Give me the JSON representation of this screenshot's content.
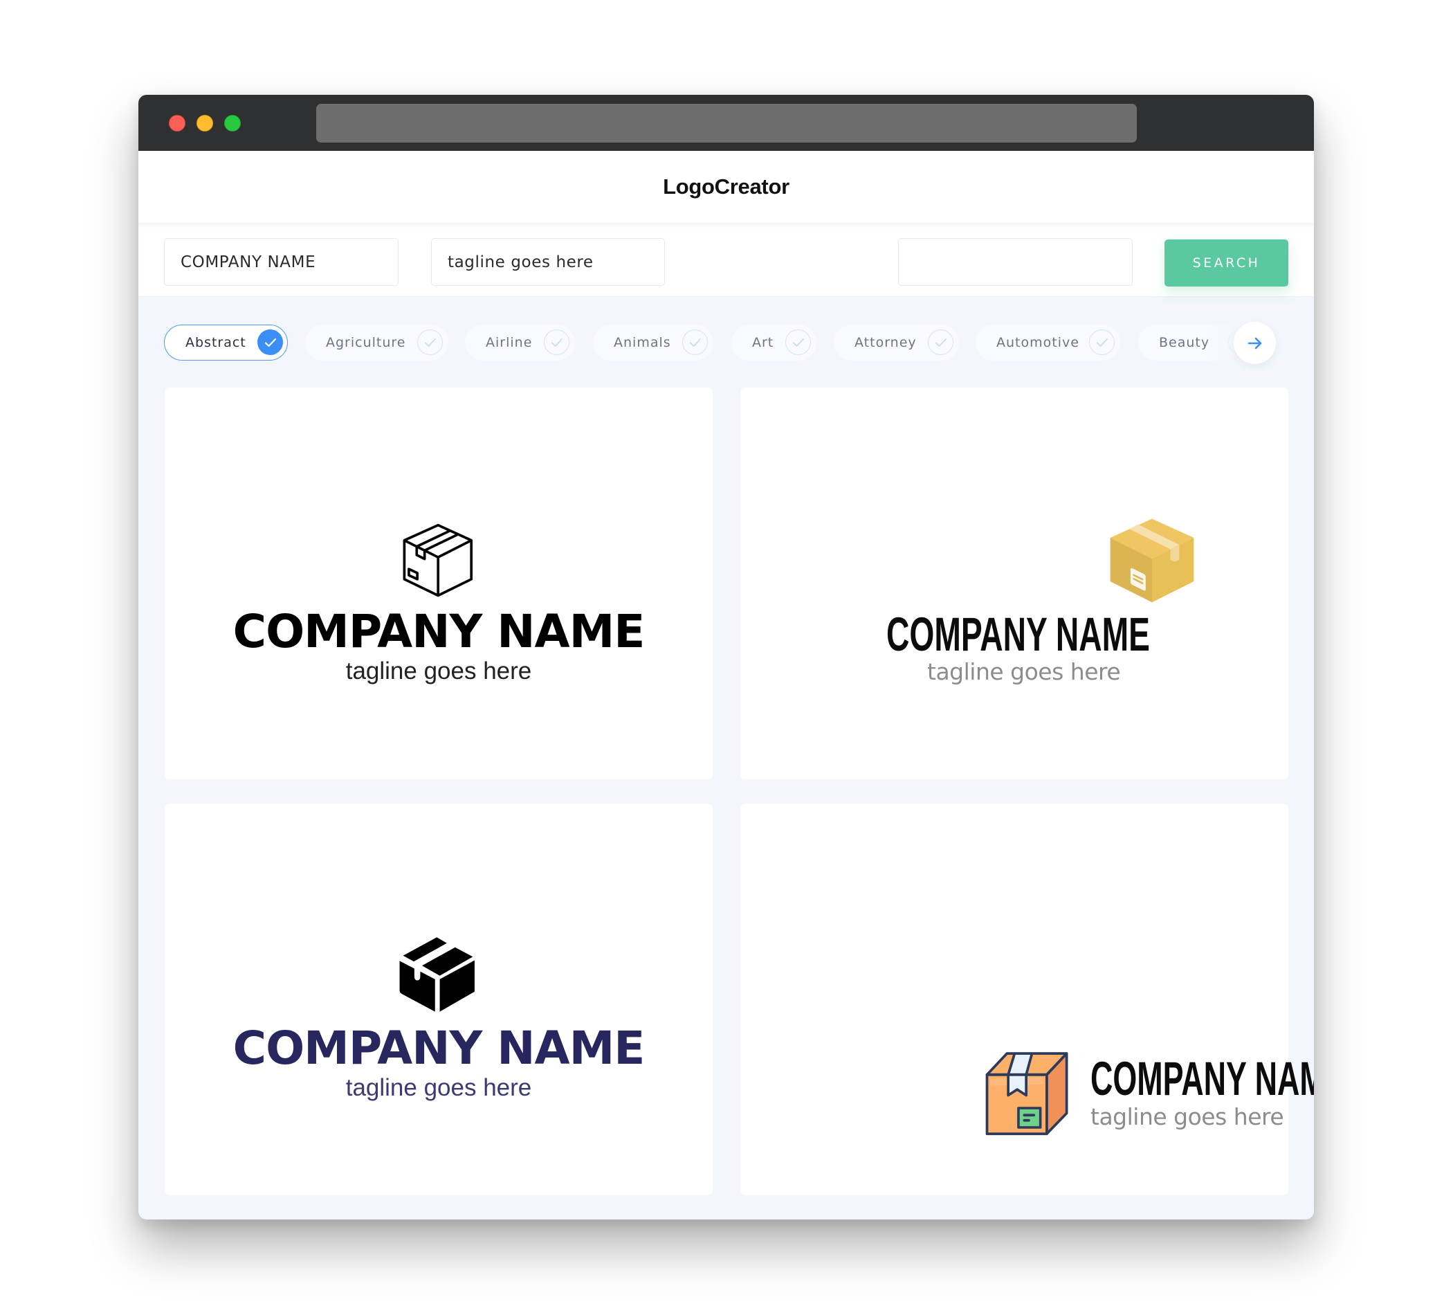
{
  "window": {
    "controls": [
      "close",
      "minimize",
      "maximize"
    ]
  },
  "header": {
    "brand": "LogoCreator"
  },
  "search": {
    "company_value": "COMPANY NAME",
    "tagline_value": "tagline goes here",
    "query_value": "",
    "button_label": "SEARCH"
  },
  "categories": {
    "items": [
      {
        "label": "Abstract",
        "selected": true
      },
      {
        "label": "Agriculture",
        "selected": false
      },
      {
        "label": "Airline",
        "selected": false
      },
      {
        "label": "Animals",
        "selected": false
      },
      {
        "label": "Art",
        "selected": false
      },
      {
        "label": "Attorney",
        "selected": false
      },
      {
        "label": "Automotive",
        "selected": false
      },
      {
        "label": "Beauty",
        "selected": false
      }
    ],
    "next_icon": "arrow-right-icon"
  },
  "logos": [
    {
      "icon": "box-outline-icon",
      "name": "COMPANY NAME",
      "tagline": "tagline goes here",
      "name_color": "#000000",
      "tagline_color": "#222222"
    },
    {
      "icon": "box-yellow-flat-icon",
      "name": "COMPANY NAME",
      "tagline": "tagline goes here",
      "name_color": "#0c0c0c",
      "tagline_color": "#8c8c8c"
    },
    {
      "icon": "box-solid-icon",
      "name": "COMPANY NAME",
      "tagline": "tagline goes here",
      "name_color": "#27265f",
      "tagline_color": "#3b3a72"
    },
    {
      "icon": "box-orange-colored-icon",
      "name": "COMPANY NAME",
      "tagline": "tagline goes here",
      "name_color": "#0c0c0c",
      "tagline_color": "#8c8c8c"
    }
  ],
  "colors": {
    "accent_blue": "#3a8ef6",
    "search_green": "#5ac9a1",
    "titlebar": "#2f3032",
    "grid_background": "#f3f6fc"
  }
}
